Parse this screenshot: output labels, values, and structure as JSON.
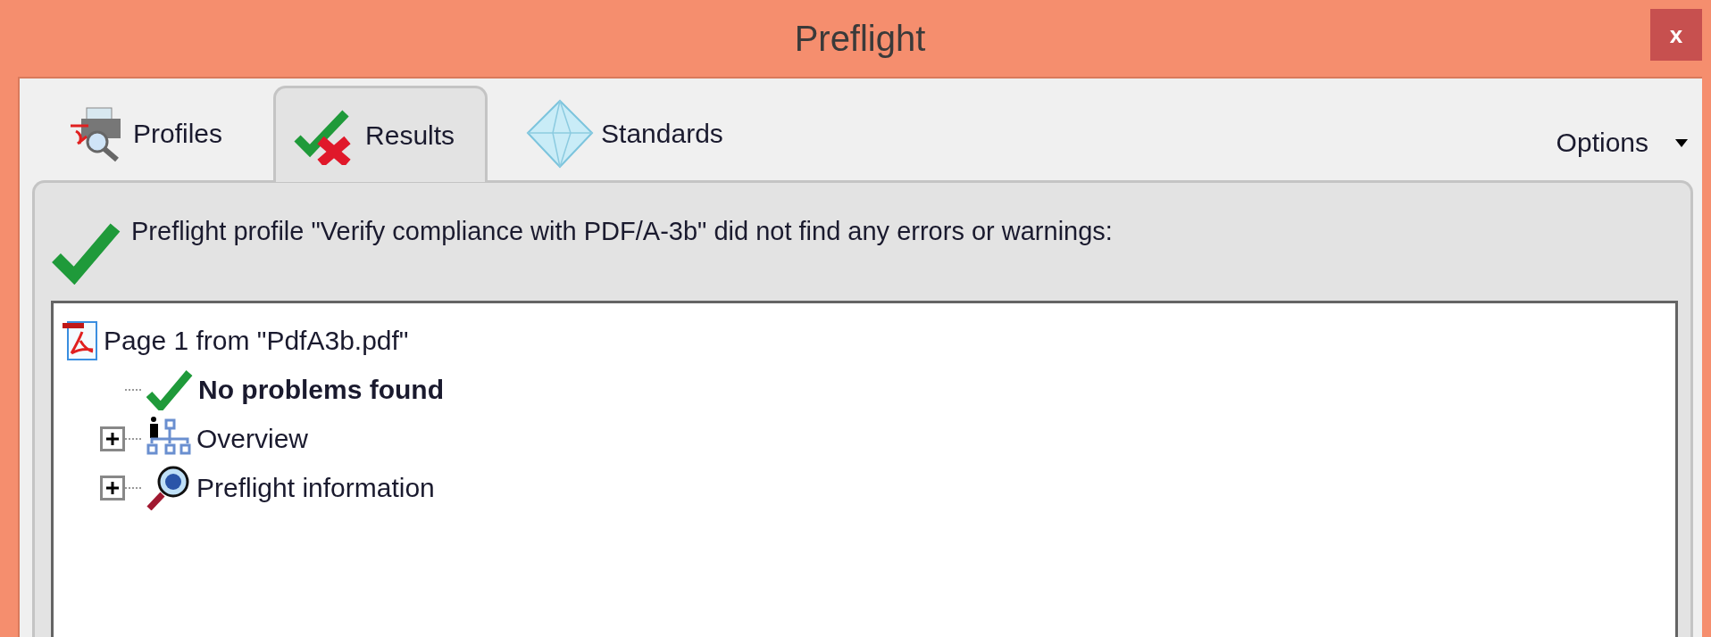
{
  "window": {
    "title": "Preflight",
    "close_label": "x"
  },
  "tabs": [
    {
      "label": "Profiles",
      "kind": "printer",
      "selected": false
    },
    {
      "label": "Results",
      "kind": "checkcross",
      "selected": true
    },
    {
      "label": "Standards",
      "kind": "diamond",
      "selected": false
    }
  ],
  "options_menu": {
    "label": "Options"
  },
  "message": "Preflight profile \"Verify compliance with PDF/A-3b\" did not find any errors or warnings:",
  "tree": [
    {
      "label": "Page 1 from \"PdfA3b.pdf\"",
      "kind": "document",
      "children": [
        {
          "label": "No problems found",
          "kind": "status"
        },
        {
          "label": "Overview",
          "kind": "hierarchy",
          "expanded": false
        },
        {
          "label": "Preflight information",
          "kind": "inspector",
          "expanded": false
        }
      ]
    }
  ]
}
